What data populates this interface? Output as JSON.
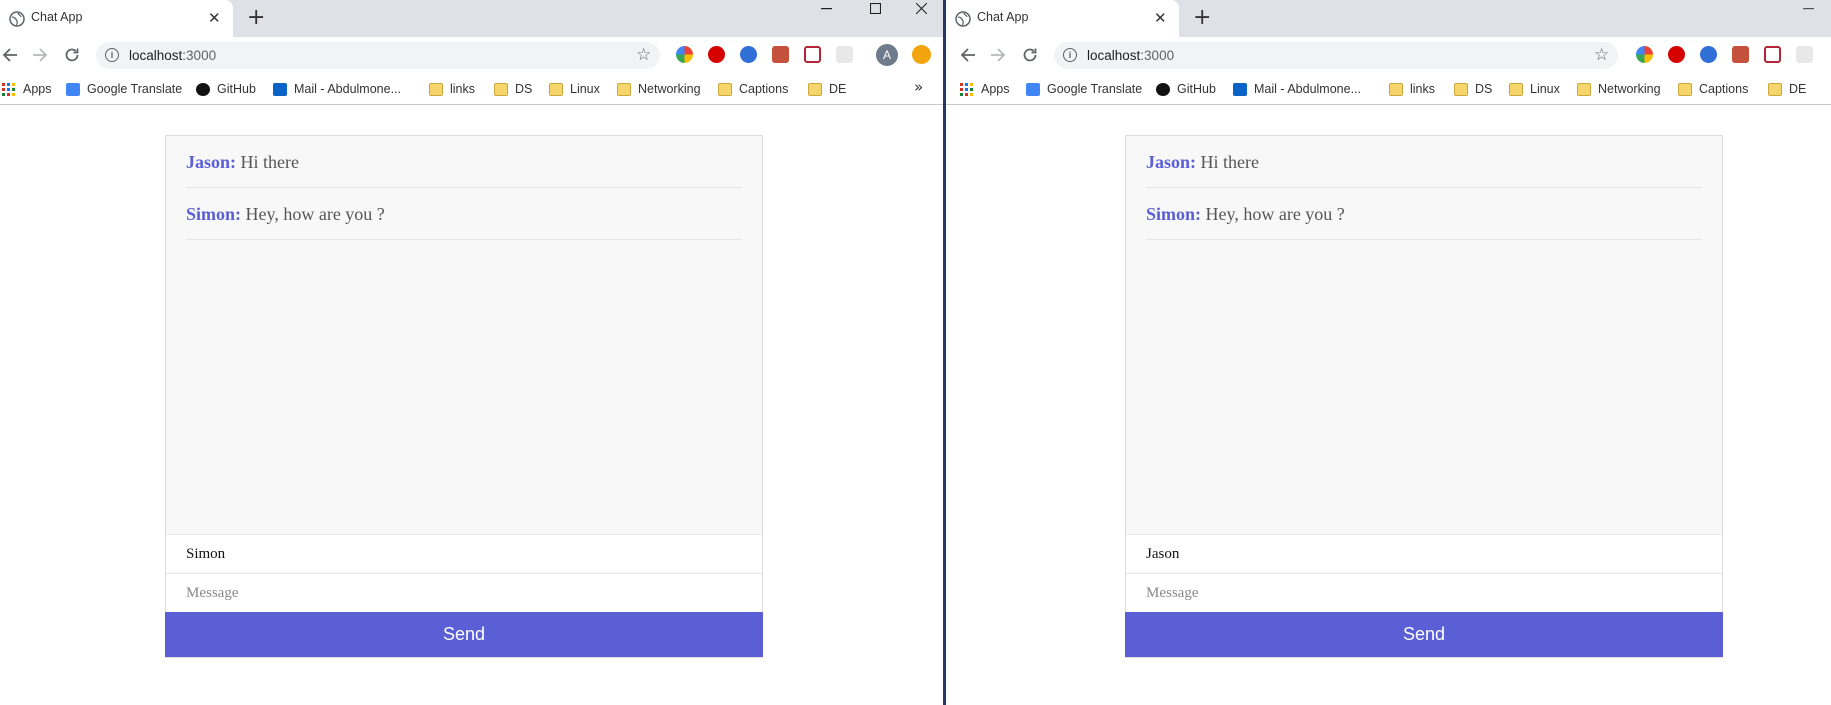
{
  "windows": [
    {
      "tab_title": "Chat App",
      "address": {
        "host": "localhost",
        "port": ":3000"
      },
      "bookmarks": [
        "Apps",
        "Google Translate",
        "GitHub",
        "Mail - Abdulmone...",
        "links",
        "DS",
        "Linux",
        "Networking",
        "Captions",
        "DE"
      ],
      "messages": [
        {
          "user": "Jason:",
          "text": "Hi there"
        },
        {
          "user": "Simon:",
          "text": "Hey, how are you ?"
        }
      ],
      "name_value": "Simon",
      "message_placeholder": "Message",
      "send_label": "Send"
    },
    {
      "tab_title": "Chat App",
      "address": {
        "host": "localhost",
        "port": ":3000"
      },
      "bookmarks": [
        "Apps",
        "Google Translate",
        "GitHub",
        "Mail - Abdulmone...",
        "links",
        "DS",
        "Linux",
        "Networking",
        "Captions",
        "DE"
      ],
      "messages": [
        {
          "user": "Jason:",
          "text": "Hi there"
        },
        {
          "user": "Simon:",
          "text": "Hey, how are you ?"
        }
      ],
      "name_value": "Jason",
      "message_placeholder": "Message",
      "send_label": "Send"
    }
  ],
  "colors": {
    "accent": "#5a5fd6",
    "tabbar": "#dee1e6",
    "chat_bg": "#f8f8f8"
  },
  "icons": [
    "globe-icon",
    "close-icon",
    "plus-icon",
    "back-icon",
    "forward-icon",
    "reload-icon",
    "info-icon",
    "star-icon",
    "minimize-icon",
    "maximize-icon",
    "apps-icon",
    "folder-icon",
    "chevron-double-right-icon"
  ]
}
